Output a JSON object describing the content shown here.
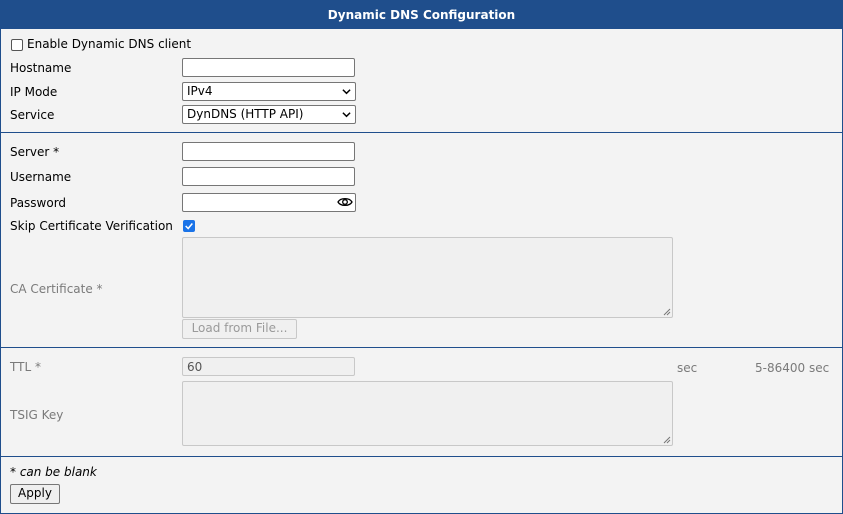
{
  "header": {
    "title": "Dynamic DNS Configuration"
  },
  "section1": {
    "enable_label": "Enable Dynamic DNS client",
    "enable_checked": false,
    "hostname_label": "Hostname",
    "hostname_value": "",
    "ipmode_label": "IP Mode",
    "ipmode_value": "IPv4",
    "service_label": "Service",
    "service_value": "DynDNS (HTTP API)"
  },
  "section2": {
    "server_label": "Server *",
    "server_value": "",
    "username_label": "Username",
    "username_value": "",
    "password_label": "Password",
    "password_value": "",
    "skipcert_label": "Skip Certificate Verification",
    "skipcert_checked": true,
    "cacert_label": "CA Certificate *",
    "cacert_value": "",
    "load_button": "Load from File..."
  },
  "section3": {
    "ttl_label": "TTL *",
    "ttl_value": "60",
    "ttl_unit": "sec",
    "ttl_range": "5-86400 sec",
    "tsig_label": "TSIG Key",
    "tsig_value": ""
  },
  "footer": {
    "note": "* can be blank",
    "apply_button": "Apply"
  },
  "icons": {
    "eye": "eye-icon",
    "chevron": "chevron-down-icon",
    "check": "check-icon"
  },
  "colors": {
    "accent": "#1f4e8c",
    "checkbox": "#1a73e8",
    "panel_bg": "#f3f3f3"
  }
}
